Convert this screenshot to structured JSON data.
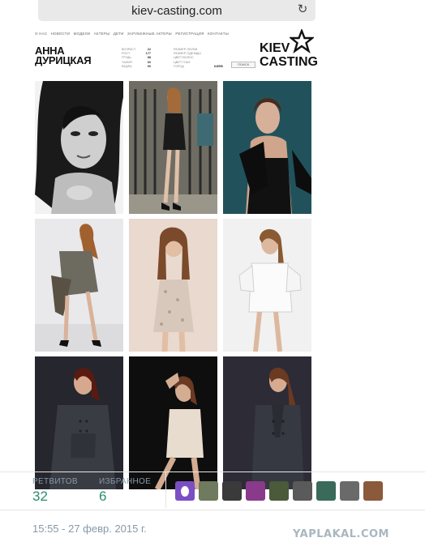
{
  "browser": {
    "url": "kiev-casting.com",
    "reload_icon": "reload-icon"
  },
  "site": {
    "nav": [
      "О НАС",
      "НОВОСТИ",
      "МОДЕЛИ",
      "АКТЕРЫ",
      "ДЕТИ",
      "ЗАРУБЕЖНЫЕ АКТЕРЫ",
      "РЕГИСТРАЦИЯ",
      "КОНТАКТЫ"
    ],
    "model_first_name": "АННА",
    "model_last_name": "ДУРИЦКАЯ",
    "stats": [
      {
        "label": "ВОЗРАСТ",
        "value": "22"
      },
      {
        "label": "РОСТ",
        "value": "177"
      },
      {
        "label": "ГРУДЬ",
        "value": "88"
      },
      {
        "label": "ТАЛИЯ",
        "value": "60"
      },
      {
        "label": "БЕДРА",
        "value": "90"
      }
    ],
    "stats_extra": [
      "РАЗМЕР ОБУВИ",
      "РАЗМЕР ОДЕЖДЫ",
      "ЦВЕТ ВОЛОС",
      "ЦВЕТ ГЛАЗ",
      "ГОРОД"
    ],
    "city": "КИЕВ",
    "search_button": "ПОИСК",
    "logo_line1": "KIEV",
    "logo_line2": "CASTING"
  },
  "tweet": {
    "retweets_label": "РЕТВИТОВ",
    "retweets_count": "32",
    "favorites_label": "ИЗБРАННОЕ",
    "favorites_count": "6",
    "timestamp": "15:55 - 27 февр. 2015 г.",
    "avatar_colors": [
      "#7b4fc4",
      "#6f7a5e",
      "#3a3a3a",
      "#8a3a8a",
      "#4a5a3a",
      "#5a5a5a",
      "#3a6a5a",
      "#6a6a6a",
      "#8a5a3a"
    ]
  },
  "watermark": "YAPLAKAL.COM"
}
